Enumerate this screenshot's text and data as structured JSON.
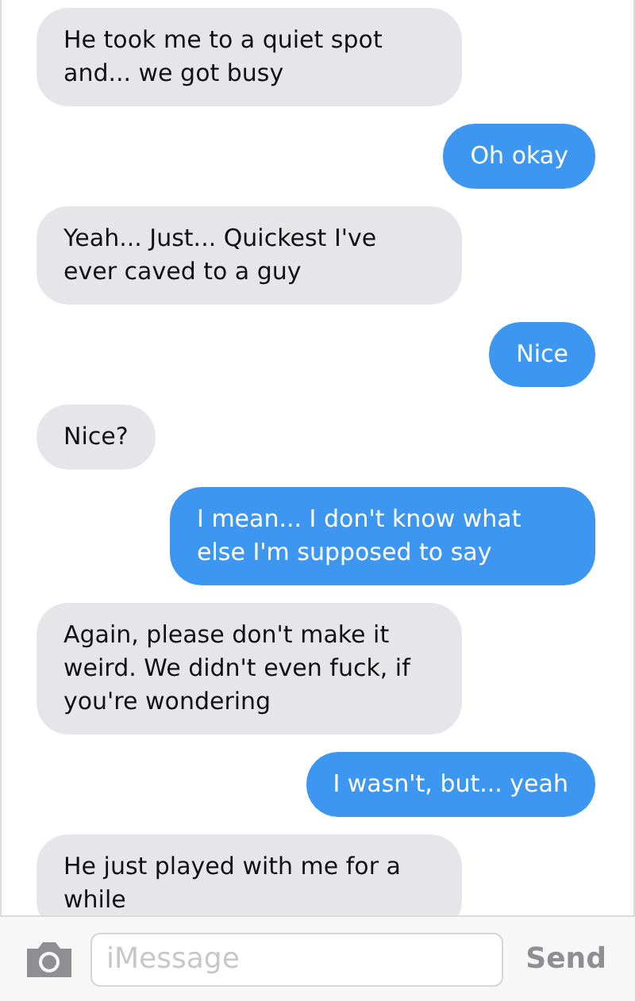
{
  "messages": [
    {
      "kind": "received",
      "text": "He took me to a quiet spot and... we got busy"
    },
    {
      "kind": "sent",
      "text": "Oh okay"
    },
    {
      "kind": "received",
      "text": "Yeah... Just... Quickest I've ever caved to a guy"
    },
    {
      "kind": "sent",
      "text": "Nice"
    },
    {
      "kind": "received",
      "text": "Nice?"
    },
    {
      "kind": "sent",
      "text": "I mean... I don't know what else I'm supposed to say"
    },
    {
      "kind": "received",
      "text": "Again, please don't make it weird. We didn't even fuck, if you're wondering"
    },
    {
      "kind": "sent",
      "text": "I wasn't, but... yeah"
    },
    {
      "kind": "received",
      "text": "He just played with me for a while"
    }
  ],
  "composer": {
    "placeholder": "iMessage",
    "send": "Send"
  }
}
